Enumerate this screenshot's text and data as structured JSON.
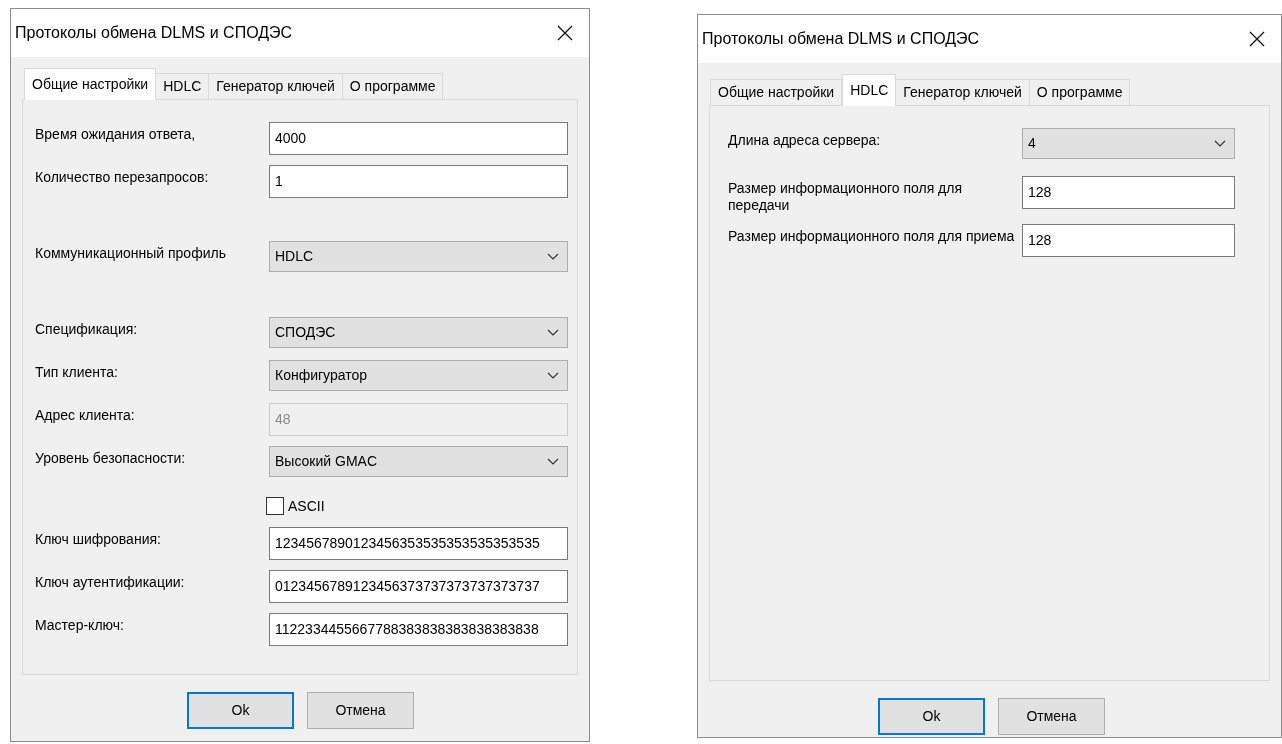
{
  "dialogs": [
    {
      "title": "Протоколы обмена DLMS и СПОДЭС",
      "tabs": [
        {
          "label": "Общие настройки",
          "selected": true
        },
        {
          "label": "HDLC",
          "selected": false
        },
        {
          "label": "Генератор ключей",
          "selected": false
        },
        {
          "label": "О программе",
          "selected": false
        }
      ],
      "sections": [
        [
          {
            "kind": "text",
            "label": "Время ожидания ответа,",
            "value": "4000",
            "disabled": false
          },
          {
            "kind": "text",
            "label": "Количество перезапросов:",
            "value": "1",
            "disabled": false
          }
        ],
        [
          {
            "kind": "select",
            "label": "Коммуникационный профиль",
            "value": "HDLC"
          }
        ],
        [
          {
            "kind": "select",
            "label": "Спецификация:",
            "value": "СПОДЭС"
          },
          {
            "kind": "select",
            "label": "Тип клиента:",
            "value": "Конфигуратор"
          },
          {
            "kind": "text",
            "label": "Адрес клиента:",
            "value": "48",
            "disabled": true
          },
          {
            "kind": "select",
            "label": "Уровень безопасности:",
            "value": "Высокий GMAC"
          },
          {
            "kind": "checkbox",
            "label": "ASCII",
            "checked": false
          },
          {
            "kind": "text",
            "label": "Ключ шифрования:",
            "value": "1234567890123456353535353535353535",
            "disabled": false
          },
          {
            "kind": "text",
            "label": "Ключ аутентификации:",
            "value": "0123456789123456373737373737373737",
            "disabled": false
          },
          {
            "kind": "text",
            "label": "Мастер-ключ:",
            "value": "1122334455667788383838383838383838",
            "disabled": false
          }
        ]
      ],
      "buttons": [
        {
          "label": "Ok",
          "default": true
        },
        {
          "label": "Отмена",
          "default": false
        }
      ]
    },
    {
      "title": "Протоколы обмена DLMS и СПОДЭС",
      "tabs": [
        {
          "label": "Общие настройки",
          "selected": false
        },
        {
          "label": "HDLC",
          "selected": true
        },
        {
          "label": "Генератор ключей",
          "selected": false
        },
        {
          "label": "О программе",
          "selected": false
        }
      ],
      "sections": [
        [
          {
            "kind": "select",
            "label": "Длина адреса сервера:",
            "value": "4"
          },
          {
            "kind": "text",
            "label": "Размер информационного поля для передачи",
            "value": "128",
            "disabled": false
          },
          {
            "kind": "text",
            "label": "Размер информационного поля для приема",
            "value": "128",
            "disabled": false
          }
        ]
      ],
      "buttons": [
        {
          "label": "Ok",
          "default": true
        },
        {
          "label": "Отмена",
          "default": false
        }
      ]
    }
  ]
}
